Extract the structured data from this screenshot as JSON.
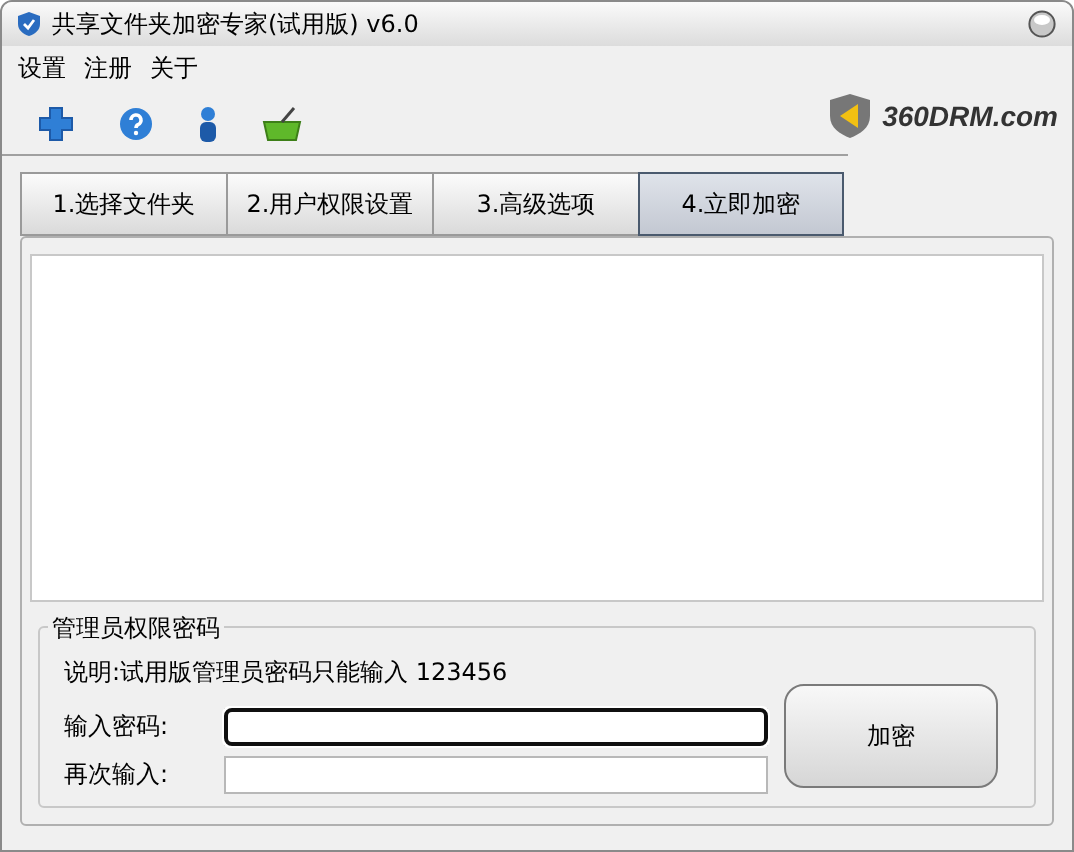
{
  "window": {
    "title": "共享文件夹加密专家(试用版) v6.0"
  },
  "menu": [
    "设置",
    "注册",
    "关于"
  ],
  "brand": {
    "text": "360DRM.com"
  },
  "tabs": [
    {
      "label": "1.选择文件夹",
      "selected": false
    },
    {
      "label": "2.用户权限设置",
      "selected": false
    },
    {
      "label": "3.高级选项",
      "selected": false
    },
    {
      "label": "4.立即加密",
      "selected": true
    }
  ],
  "password_group": {
    "title": "管理员权限密码",
    "note": "说明:试用版管理员密码只能输入 123456",
    "fields": [
      {
        "label": "输入密码:",
        "focused": true
      },
      {
        "label": "再次输入:",
        "focused": false
      }
    ],
    "button": "加密"
  }
}
